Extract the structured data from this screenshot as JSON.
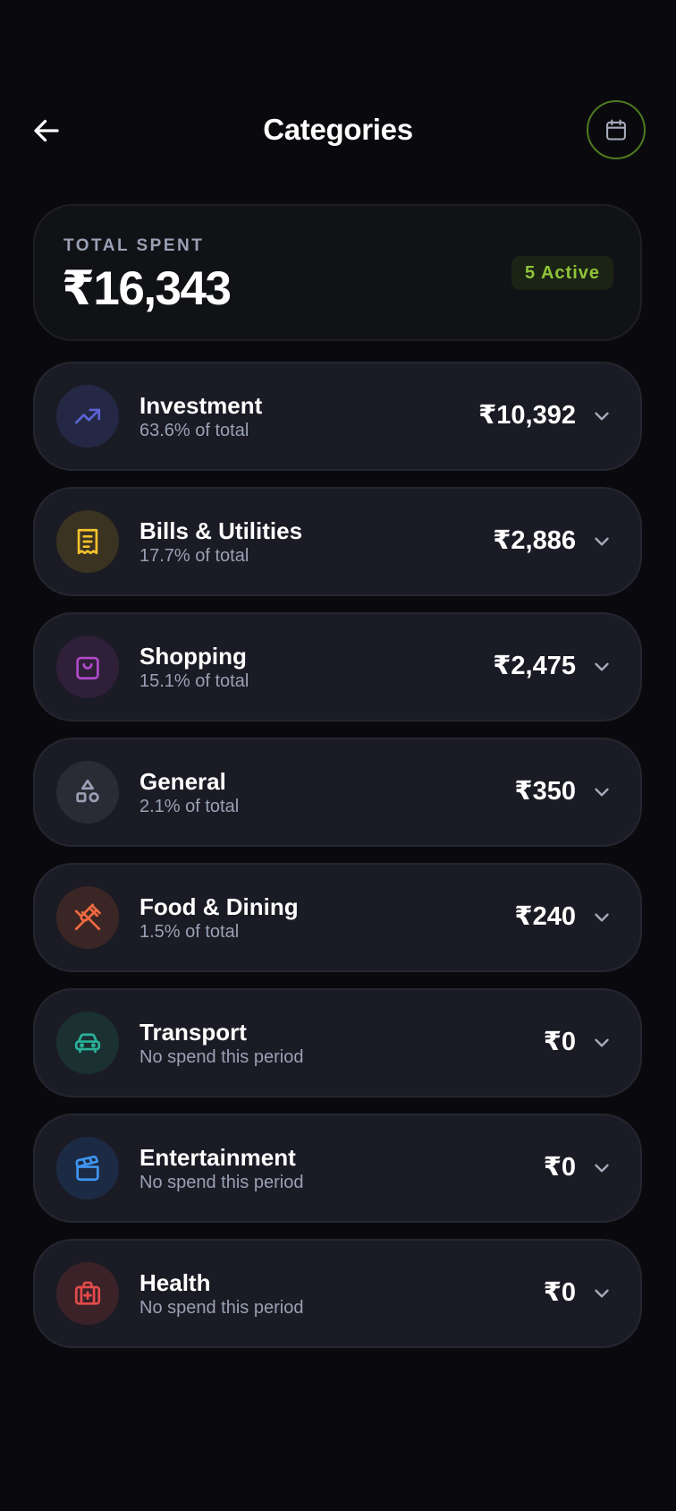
{
  "header": {
    "title": "Categories"
  },
  "summary": {
    "label": "TOTAL SPENT",
    "amount": "₹16,343",
    "badge": "5 Active"
  },
  "categories": [
    {
      "name": "Investment",
      "sub": "63.6% of total",
      "amount": "₹10,392",
      "icon": "trending-up-icon",
      "color": "#5b63d3",
      "bg": "#252845"
    },
    {
      "name": "Bills & Utilities",
      "sub": "17.7% of total",
      "amount": "₹2,886",
      "icon": "receipt-icon",
      "color": "#f5c22e",
      "bg": "#3a3322"
    },
    {
      "name": "Shopping",
      "sub": "15.1% of total",
      "amount": "₹2,475",
      "icon": "shopping-bag-icon",
      "color": "#b04cc9",
      "bg": "#2f1f39"
    },
    {
      "name": "General",
      "sub": "2.1% of total",
      "amount": "₹350",
      "icon": "shapes-icon",
      "color": "#9aa0b5",
      "bg": "#2a2c35"
    },
    {
      "name": "Food & Dining",
      "sub": "1.5% of total",
      "amount": "₹240",
      "icon": "utensils-crossed-icon",
      "color": "#f06a41",
      "bg": "#3b2626"
    },
    {
      "name": "Transport",
      "sub": "No spend this period",
      "amount": "₹0",
      "icon": "car-icon",
      "color": "#2bb39a",
      "bg": "#1b3131"
    },
    {
      "name": "Entertainment",
      "sub": "No spend this period",
      "amount": "₹0",
      "icon": "clapperboard-icon",
      "color": "#3f95f0",
      "bg": "#1c2a44"
    },
    {
      "name": "Health",
      "sub": "No spend this period",
      "amount": "₹0",
      "icon": "first-aid-kit-icon",
      "color": "#e44a4a",
      "bg": "#3a2228"
    }
  ]
}
